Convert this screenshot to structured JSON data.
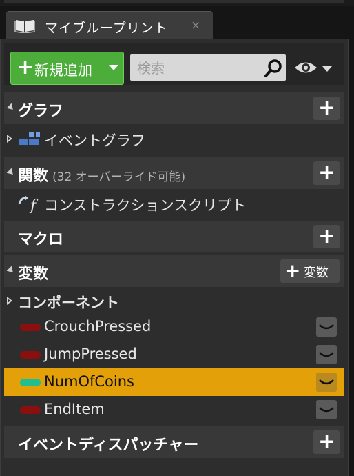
{
  "tab": {
    "title": "マイブループリント",
    "close": "×"
  },
  "toolbar": {
    "add_label": "新規追加",
    "search_placeholder": "検索"
  },
  "sections": {
    "graph": {
      "title": "グラフ",
      "items": [
        "イベントグラフ"
      ]
    },
    "functions": {
      "title": "関数",
      "subtitle": "(32 オーバーライド可能)",
      "items": [
        "コンストラクションスクリプト"
      ]
    },
    "macros": {
      "title": "マクロ"
    },
    "variables": {
      "title": "変数",
      "add_label": "変数",
      "components_label": "コンポーネント",
      "items": [
        {
          "name": "CrouchPressed",
          "color": "#8a1010",
          "selected": false
        },
        {
          "name": "JumpPressed",
          "color": "#8a1010",
          "selected": false
        },
        {
          "name": "NumOfCoins",
          "color": "#1fbf8f",
          "selected": true
        },
        {
          "name": "EndItem",
          "color": "#8a1010",
          "selected": false
        }
      ]
    },
    "dispatchers": {
      "title": "イベントディスパッチャー"
    }
  },
  "colors": {
    "accent_add": "#4cad3a",
    "selection": "#e3a008"
  }
}
